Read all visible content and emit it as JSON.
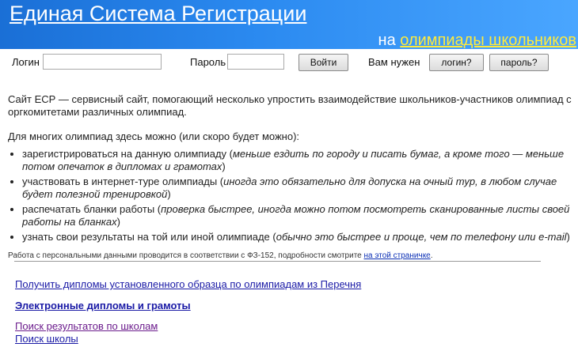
{
  "header": {
    "title": "Единая Система Регистрации",
    "subtitle_prefix": "на ",
    "subtitle_link": "олимпиады школьников"
  },
  "login": {
    "login_label": "Логин",
    "login_value": "",
    "password_label": "Пароль",
    "password_value": "",
    "submit_label": "Войти",
    "need_label": "Вам нужен",
    "forgot_login_label": "логин?",
    "forgot_password_label": "пароль?"
  },
  "intro": {
    "p1": "Сайт ЕСР — сервисный сайт, помогающий несколько упростить взаимодействие школьников-участников олимпиад с оргкомитетами различных олимпиад.",
    "p2": "Для многих олимпиад здесь можно (или скоро будет можно):",
    "features": [
      {
        "text": "зарегистрироваться на данную олимпиаду (",
        "note": "меньше ездить по городу и писать бумаг, а кроме того — меньше потом опечаток в дипломах и грамотах",
        "close": ")"
      },
      {
        "text": "участвовать в интернет-туре олимпиады (",
        "note": "иногда это обязательно для допуска на очный тур, в любом случае будет полезной тренировкой",
        "close": ")"
      },
      {
        "text": "распечатать бланки работы (",
        "note": "проверка быстрее, иногда можно потом посмотреть сканированные листы своей работы на бланках",
        "close": ")"
      },
      {
        "text": "узнать свои результаты на той или иной олимпиаде (",
        "note": "обычно это быстрее и проще, чем по телефону или e-mail",
        "close": ")"
      }
    ],
    "privacy_text": "Работа с персональными данными проводится в соответствии с ФЗ-152, подробности смотрите ",
    "privacy_link": "на этой страничке",
    "privacy_end": "."
  },
  "links": {
    "diplomas_list": "Получить дипломы установленного образца по олимпиадам из Перечня",
    "electronic_diplomas": "Электронные дипломы и грамоты",
    "school_results": "Поиск результатов по школам",
    "school_search": "Поиск школы"
  },
  "colors": {
    "banner_start": "#1a6fd6",
    "banner_end": "#4aa6ff",
    "banner_highlight": "#ffeb3b",
    "link": "#1a1aa6",
    "visited_link": "#6b1b8c"
  }
}
